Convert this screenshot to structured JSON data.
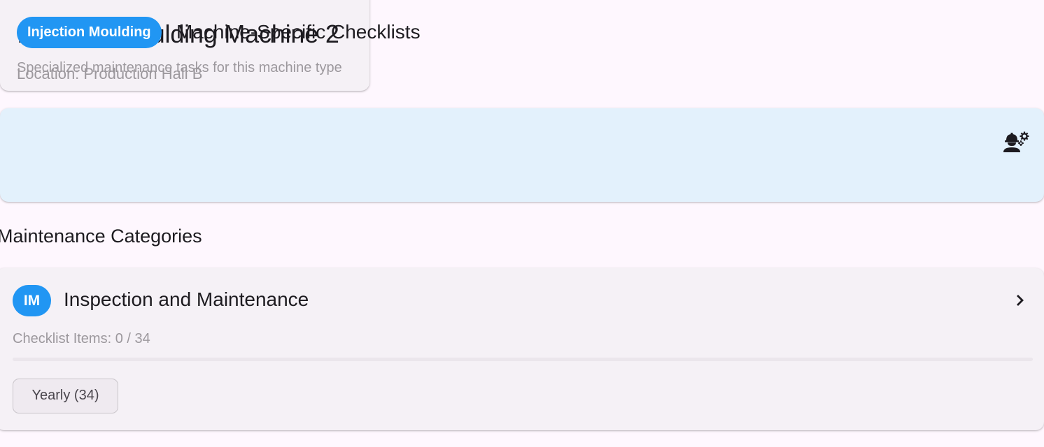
{
  "machine": {
    "title": "Injection Moulding Machine 2",
    "location": "Location: Production Hall B"
  },
  "specific_checklists": {
    "type_chip": "Injection Moulding",
    "title": "Machine-Specific Checklists",
    "subtitle": "Specialized maintenance tasks for this machine type",
    "icon": "engineer-icon"
  },
  "categories_section": {
    "heading": "Maintenance Categories",
    "items": [
      {
        "avatar": "IM",
        "title": "Inspection and Maintenance",
        "count_label": "Checklist Items: 0 / 34",
        "progress": 0,
        "frequency_chip": "Yearly (34)",
        "icon": "chevron-right-icon"
      }
    ]
  },
  "colors": {
    "background": "#fef7fe",
    "card": "#f5f1f6",
    "banner": "#e3f1fc",
    "accent": "#2196f3",
    "muted_text": "#9c989d"
  }
}
